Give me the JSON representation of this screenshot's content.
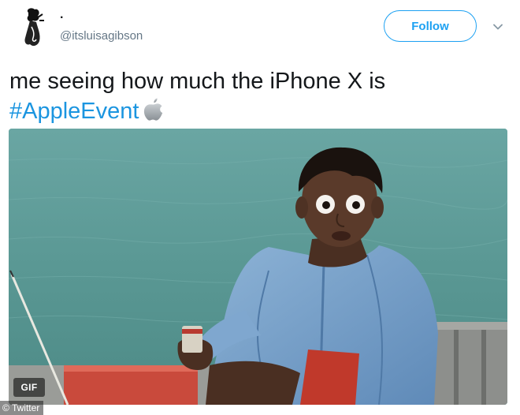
{
  "tweet": {
    "display_name": ".",
    "handle": "@itsluisagibson",
    "follow_label": "Follow",
    "text_line1": "me seeing how much the iPhone X is",
    "hashtag": "#AppleEvent",
    "emoji_icon": "apple-logo-icon",
    "media_badge": "GIF",
    "image_credit": "© Twitter"
  },
  "colors": {
    "accent": "#1da1f2",
    "hashtag": "#1b95e0",
    "secondary_text": "#657786",
    "primary_text": "#14171a"
  }
}
